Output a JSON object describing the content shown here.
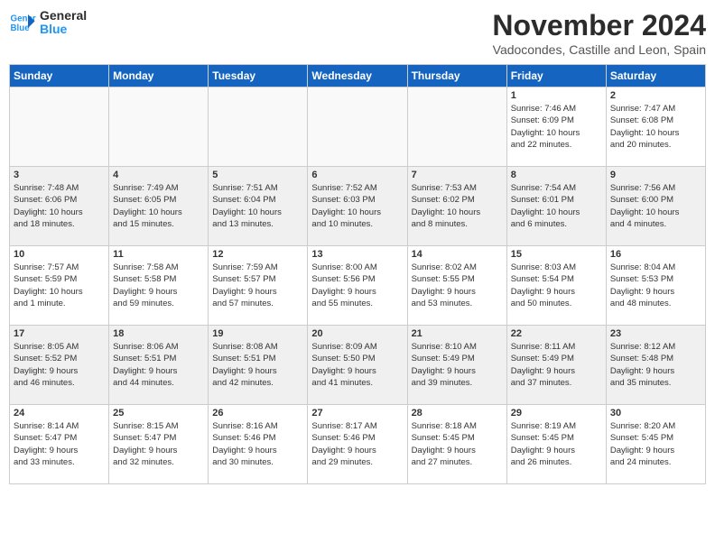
{
  "logo": {
    "line1": "General",
    "line2": "Blue"
  },
  "title": "November 2024",
  "subtitle": "Vadocondes, Castille and Leon, Spain",
  "weekdays": [
    "Sunday",
    "Monday",
    "Tuesday",
    "Wednesday",
    "Thursday",
    "Friday",
    "Saturday"
  ],
  "weeks": [
    [
      {
        "day": "",
        "info": ""
      },
      {
        "day": "",
        "info": ""
      },
      {
        "day": "",
        "info": ""
      },
      {
        "day": "",
        "info": ""
      },
      {
        "day": "",
        "info": ""
      },
      {
        "day": "1",
        "info": "Sunrise: 7:46 AM\nSunset: 6:09 PM\nDaylight: 10 hours\nand 22 minutes."
      },
      {
        "day": "2",
        "info": "Sunrise: 7:47 AM\nSunset: 6:08 PM\nDaylight: 10 hours\nand 20 minutes."
      }
    ],
    [
      {
        "day": "3",
        "info": "Sunrise: 7:48 AM\nSunset: 6:06 PM\nDaylight: 10 hours\nand 18 minutes."
      },
      {
        "day": "4",
        "info": "Sunrise: 7:49 AM\nSunset: 6:05 PM\nDaylight: 10 hours\nand 15 minutes."
      },
      {
        "day": "5",
        "info": "Sunrise: 7:51 AM\nSunset: 6:04 PM\nDaylight: 10 hours\nand 13 minutes."
      },
      {
        "day": "6",
        "info": "Sunrise: 7:52 AM\nSunset: 6:03 PM\nDaylight: 10 hours\nand 10 minutes."
      },
      {
        "day": "7",
        "info": "Sunrise: 7:53 AM\nSunset: 6:02 PM\nDaylight: 10 hours\nand 8 minutes."
      },
      {
        "day": "8",
        "info": "Sunrise: 7:54 AM\nSunset: 6:01 PM\nDaylight: 10 hours\nand 6 minutes."
      },
      {
        "day": "9",
        "info": "Sunrise: 7:56 AM\nSunset: 6:00 PM\nDaylight: 10 hours\nand 4 minutes."
      }
    ],
    [
      {
        "day": "10",
        "info": "Sunrise: 7:57 AM\nSunset: 5:59 PM\nDaylight: 10 hours\nand 1 minute."
      },
      {
        "day": "11",
        "info": "Sunrise: 7:58 AM\nSunset: 5:58 PM\nDaylight: 9 hours\nand 59 minutes."
      },
      {
        "day": "12",
        "info": "Sunrise: 7:59 AM\nSunset: 5:57 PM\nDaylight: 9 hours\nand 57 minutes."
      },
      {
        "day": "13",
        "info": "Sunrise: 8:00 AM\nSunset: 5:56 PM\nDaylight: 9 hours\nand 55 minutes."
      },
      {
        "day": "14",
        "info": "Sunrise: 8:02 AM\nSunset: 5:55 PM\nDaylight: 9 hours\nand 53 minutes."
      },
      {
        "day": "15",
        "info": "Sunrise: 8:03 AM\nSunset: 5:54 PM\nDaylight: 9 hours\nand 50 minutes."
      },
      {
        "day": "16",
        "info": "Sunrise: 8:04 AM\nSunset: 5:53 PM\nDaylight: 9 hours\nand 48 minutes."
      }
    ],
    [
      {
        "day": "17",
        "info": "Sunrise: 8:05 AM\nSunset: 5:52 PM\nDaylight: 9 hours\nand 46 minutes."
      },
      {
        "day": "18",
        "info": "Sunrise: 8:06 AM\nSunset: 5:51 PM\nDaylight: 9 hours\nand 44 minutes."
      },
      {
        "day": "19",
        "info": "Sunrise: 8:08 AM\nSunset: 5:51 PM\nDaylight: 9 hours\nand 42 minutes."
      },
      {
        "day": "20",
        "info": "Sunrise: 8:09 AM\nSunset: 5:50 PM\nDaylight: 9 hours\nand 41 minutes."
      },
      {
        "day": "21",
        "info": "Sunrise: 8:10 AM\nSunset: 5:49 PM\nDaylight: 9 hours\nand 39 minutes."
      },
      {
        "day": "22",
        "info": "Sunrise: 8:11 AM\nSunset: 5:49 PM\nDaylight: 9 hours\nand 37 minutes."
      },
      {
        "day": "23",
        "info": "Sunrise: 8:12 AM\nSunset: 5:48 PM\nDaylight: 9 hours\nand 35 minutes."
      }
    ],
    [
      {
        "day": "24",
        "info": "Sunrise: 8:14 AM\nSunset: 5:47 PM\nDaylight: 9 hours\nand 33 minutes."
      },
      {
        "day": "25",
        "info": "Sunrise: 8:15 AM\nSunset: 5:47 PM\nDaylight: 9 hours\nand 32 minutes."
      },
      {
        "day": "26",
        "info": "Sunrise: 8:16 AM\nSunset: 5:46 PM\nDaylight: 9 hours\nand 30 minutes."
      },
      {
        "day": "27",
        "info": "Sunrise: 8:17 AM\nSunset: 5:46 PM\nDaylight: 9 hours\nand 29 minutes."
      },
      {
        "day": "28",
        "info": "Sunrise: 8:18 AM\nSunset: 5:45 PM\nDaylight: 9 hours\nand 27 minutes."
      },
      {
        "day": "29",
        "info": "Sunrise: 8:19 AM\nSunset: 5:45 PM\nDaylight: 9 hours\nand 26 minutes."
      },
      {
        "day": "30",
        "info": "Sunrise: 8:20 AM\nSunset: 5:45 PM\nDaylight: 9 hours\nand 24 minutes."
      }
    ]
  ]
}
